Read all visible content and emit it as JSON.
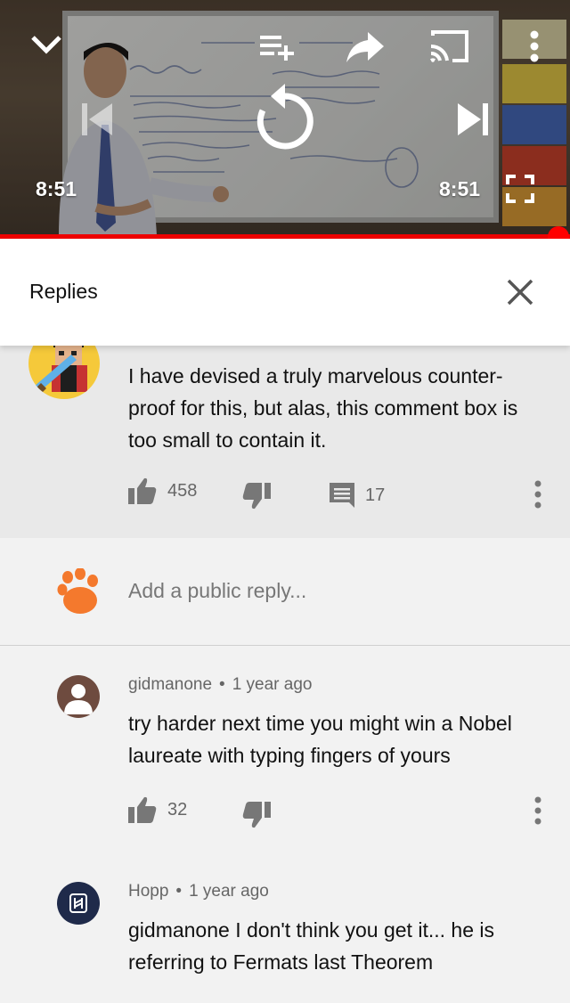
{
  "player": {
    "time_left": "8:51",
    "time_right": "8:51",
    "progress": 1.0,
    "colors": {
      "progress": "#ff0000"
    }
  },
  "replies_panel": {
    "title": "Replies"
  },
  "parent_comment": {
    "text": "I have devised a truly marvelous counter-proof for this, but alas, this comment box is too small to contain it.",
    "likes": "458",
    "replies": "17"
  },
  "add_reply": {
    "placeholder": "Add a public reply..."
  },
  "replies": [
    {
      "author": "gidmanone",
      "time": "1 year ago",
      "text": "try harder next time you might win a Nobel laureate with typing fingers of yours",
      "likes": "32"
    },
    {
      "author": "Hopp",
      "time": "1 year ago",
      "text": "gidmanone I don't think you get it... he is referring to Fermats last Theorem"
    }
  ]
}
